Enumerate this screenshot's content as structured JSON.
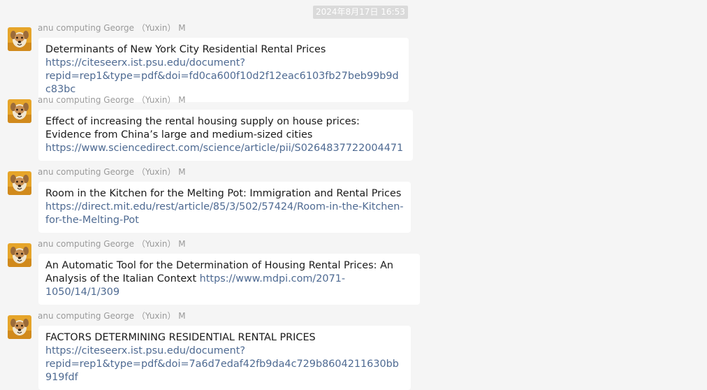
{
  "chat": {
    "timestamp": "2024年8月17日 16:53",
    "sender_name": "anu computing George （Yuxin） M",
    "messages": [
      {
        "text": "Determinants of New York City Residential Rental Prices ",
        "link": "https://citeseerx.ist.psu.edu/document?repid=rep1&type=pdf&doi=fd0ca600f10d2f12eac6103fb27beb99b9dc83bc"
      },
      {
        "text": "Effect of increasing the rental housing supply on house prices: Evidence from China’s large and medium-sized cities ",
        "link": "https://www.sciencedirect.com/science/article/pii/S0264837722004471"
      },
      {
        "text": "Room in the Kitchen for the Melting Pot: Immigration and Rental Prices ",
        "link": "https://direct.mit.edu/rest/article/85/3/502/57424/Room-in-the-Kitchen-for-the-Melting-Pot"
      },
      {
        "text": "An Automatic Tool for the Determination of Housing Rental Prices: An Analysis of the Italian Context ",
        "link": "https://www.mdpi.com/2071-1050/14/1/309"
      },
      {
        "text": "FACTORS DETERMINING RESIDENTIAL RENTAL PRICES   ",
        "link": "https://citeseerx.ist.psu.edu/document?repid=rep1&type=pdf&doi=7a6d7edaf42fb9da4c729b8604211630bb919fdf"
      }
    ]
  },
  "colors": {
    "background": "#f5f5f5",
    "bubble": "#ffffff",
    "link": "#4e6a92",
    "sender": "#9a9a9a",
    "timestamp_bg": "#dadada"
  },
  "icons": {
    "avatar": "dog-avatar-icon"
  }
}
